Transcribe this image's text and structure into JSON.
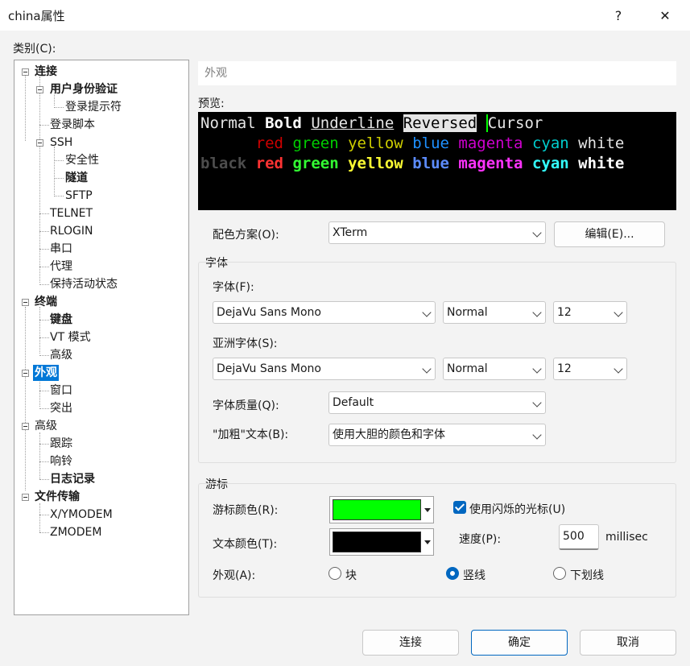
{
  "window": {
    "title": "china属性",
    "help_label": "?",
    "close_label": "✕"
  },
  "category_label": "类别(C):",
  "tree": {
    "items": [
      {
        "label": "连接"
      },
      {
        "label": "用户身份验证"
      },
      {
        "label": "登录提示符"
      },
      {
        "label": "登录脚本"
      },
      {
        "label": "SSH"
      },
      {
        "label": "安全性"
      },
      {
        "label": "隧道"
      },
      {
        "label": "SFTP"
      },
      {
        "label": "TELNET"
      },
      {
        "label": "RLOGIN"
      },
      {
        "label": "串口"
      },
      {
        "label": "代理"
      },
      {
        "label": "保持活动状态"
      },
      {
        "label": "终端"
      },
      {
        "label": "键盘"
      },
      {
        "label": "VT 模式"
      },
      {
        "label": "高级"
      },
      {
        "label": "外观"
      },
      {
        "label": "窗口"
      },
      {
        "label": "突出"
      },
      {
        "label": "高级"
      },
      {
        "label": "跟踪"
      },
      {
        "label": "响铃"
      },
      {
        "label": "日志记录"
      },
      {
        "label": "文件传输"
      },
      {
        "label": "X/YMODEM"
      },
      {
        "label": "ZMODEM"
      }
    ]
  },
  "section_title": "外观",
  "preview": {
    "label": "预览:",
    "line1": {
      "normal": "Normal",
      "bold": "Bold",
      "underline": "Underline",
      "reversed": "Reversed",
      "cursor": "Cursor"
    },
    "colors": [
      "black",
      "red",
      "green",
      "yellow",
      "blue",
      "magenta",
      "cyan",
      "white"
    ]
  },
  "color_scheme": {
    "label": "配色方案(O):",
    "value": "XTerm",
    "edit_button": "编辑(E)..."
  },
  "font_group": {
    "title": "字体",
    "font_label": "字体(F):",
    "font_value": "DejaVu Sans Mono",
    "font_style": "Normal",
    "font_size": "12",
    "asian_label": "亚洲字体(S):",
    "asian_value": "DejaVu Sans Mono",
    "asian_style": "Normal",
    "asian_size": "12",
    "quality_label": "字体质量(Q):",
    "quality_value": "Default",
    "bold_label": "\"加粗\"文本(B):",
    "bold_value": "使用大胆的颜色和字体"
  },
  "cursor_group": {
    "title": "游标",
    "cursor_color_label": "游标颜色(R):",
    "cursor_color": "#00ff00",
    "text_color_label": "文本颜色(T):",
    "text_color": "#000000",
    "blink_label": "使用闪烁的光标(U)",
    "blink_checked": true,
    "speed_label": "速度(P):",
    "speed_value": "500",
    "speed_unit": "millisec",
    "appearance_label": "外观(A):",
    "options": [
      "块",
      "竖线",
      "下划线"
    ],
    "selected_option": "竖线"
  },
  "buttons": {
    "connect": "连接",
    "ok": "确定",
    "cancel": "取消"
  },
  "colors": {
    "accent": "#0067c0",
    "selection": "#0078d7"
  }
}
